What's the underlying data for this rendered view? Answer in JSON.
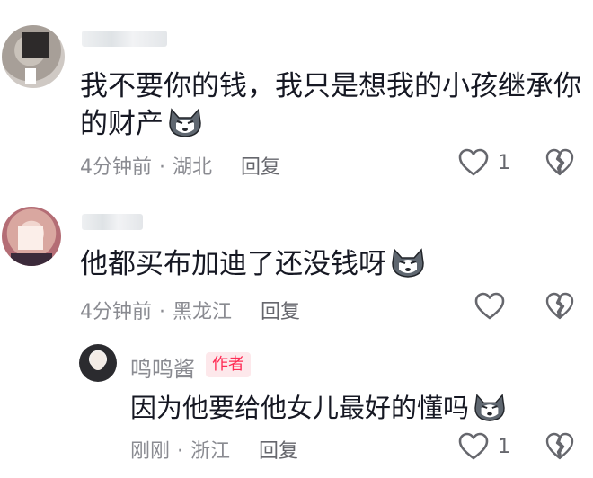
{
  "colors": {
    "text": "#161823",
    "meta": "#8a8b91",
    "author_badge_bg": "#fde8eb",
    "author_badge_text": "#fe2c55"
  },
  "comments": [
    {
      "text_line1": "我不要你的钱，我只是想我的小孩继承你",
      "text_line2": "的财产",
      "emoji": "husky-emoji",
      "time": "4分钟前",
      "location": "湖北",
      "reply_label": "回复",
      "like_count": "1"
    },
    {
      "text": "他都买布加迪了还没钱呀",
      "emoji": "husky-emoji",
      "time": "4分钟前",
      "location": "黑龙江",
      "reply_label": "回复",
      "like_count": ""
    }
  ],
  "reply": {
    "author": "鸣鸣酱",
    "badge": "作者",
    "text": "因为他要给他女儿最好的懂吗",
    "emoji": "husky-emoji",
    "time": "刚刚",
    "location": "浙江",
    "reply_label": "回复",
    "like_count": "1"
  },
  "separator": "·"
}
